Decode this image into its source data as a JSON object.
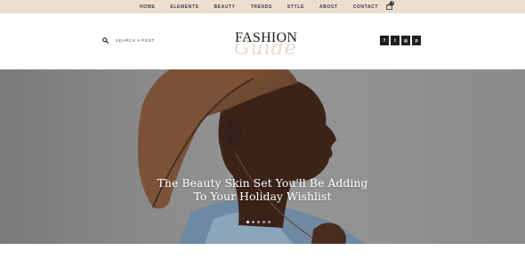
{
  "nav": {
    "items": [
      "HOME",
      "ELEMENTS",
      "BEAUTY",
      "TRENDS",
      "STYLE",
      "ABOUT",
      "CONTACT"
    ],
    "cart_count": "0"
  },
  "header": {
    "search_placeholder": "SEARCH A POST",
    "logo_word": "FASHION",
    "logo_script": "Guide",
    "social": [
      {
        "icon": "facebook-icon",
        "glyph": "f"
      },
      {
        "icon": "twitter-icon",
        "glyph": "t"
      },
      {
        "icon": "instagram-icon",
        "glyph": "◎"
      },
      {
        "icon": "pinterest-icon",
        "glyph": "p"
      }
    ]
  },
  "hero": {
    "headline_line1": "The Beauty Skin Set You'll Be Adding",
    "headline_line2": "To Your Holiday Wishlist",
    "slides": 5,
    "active_slide": 1
  },
  "colors": {
    "nav_bg": "#ecdfd0",
    "hat": "#7a5238",
    "skin": "#3b2318"
  }
}
